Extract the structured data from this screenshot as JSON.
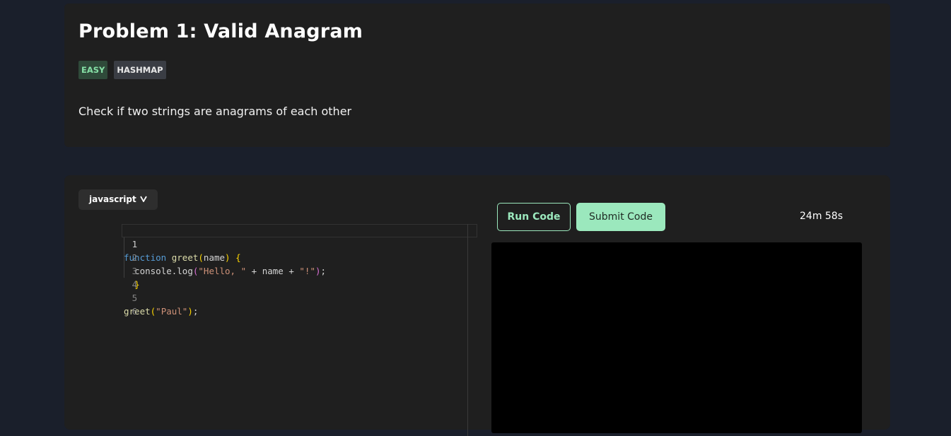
{
  "problem": {
    "title": "Problem 1: Valid Anagram",
    "tags": [
      "EASY",
      "HASHMAP"
    ],
    "description": "Check if two strings are anagrams of each other"
  },
  "editor": {
    "language": "javascript",
    "line_numbers": [
      "1",
      "2",
      "3",
      "4",
      "5",
      "6"
    ],
    "code_tokens": {
      "l1_kw": "function",
      "l1_fn": "greet",
      "l1_open": "(",
      "l1_param": "name",
      "l1_close": ")",
      "l1_brace": "{",
      "l2_obj": "console.log",
      "l2_open": "(",
      "l2_str1": "\"Hello, \"",
      "l2_mid": " + name + ",
      "l2_str2": "\"!\"",
      "l2_close": ")",
      "l2_semi": ";",
      "l3_brace": "}",
      "l5_fn": "greet",
      "l5_open": "(",
      "l5_str": "\"Paul\"",
      "l5_close": ")",
      "l5_semi": ";"
    }
  },
  "toolbar": {
    "run_label": "Run Code",
    "submit_label": "Submit Code",
    "timer": "24m 58s"
  },
  "colors": {
    "accent": "#9be8bd",
    "easy_tag_bg": "#2f4a3a",
    "easy_tag_text": "#86e0a6",
    "background": "#1a1f2b",
    "card": "#1f1f1f"
  },
  "icons": {
    "language_dropdown": "chevron-down-icon"
  }
}
